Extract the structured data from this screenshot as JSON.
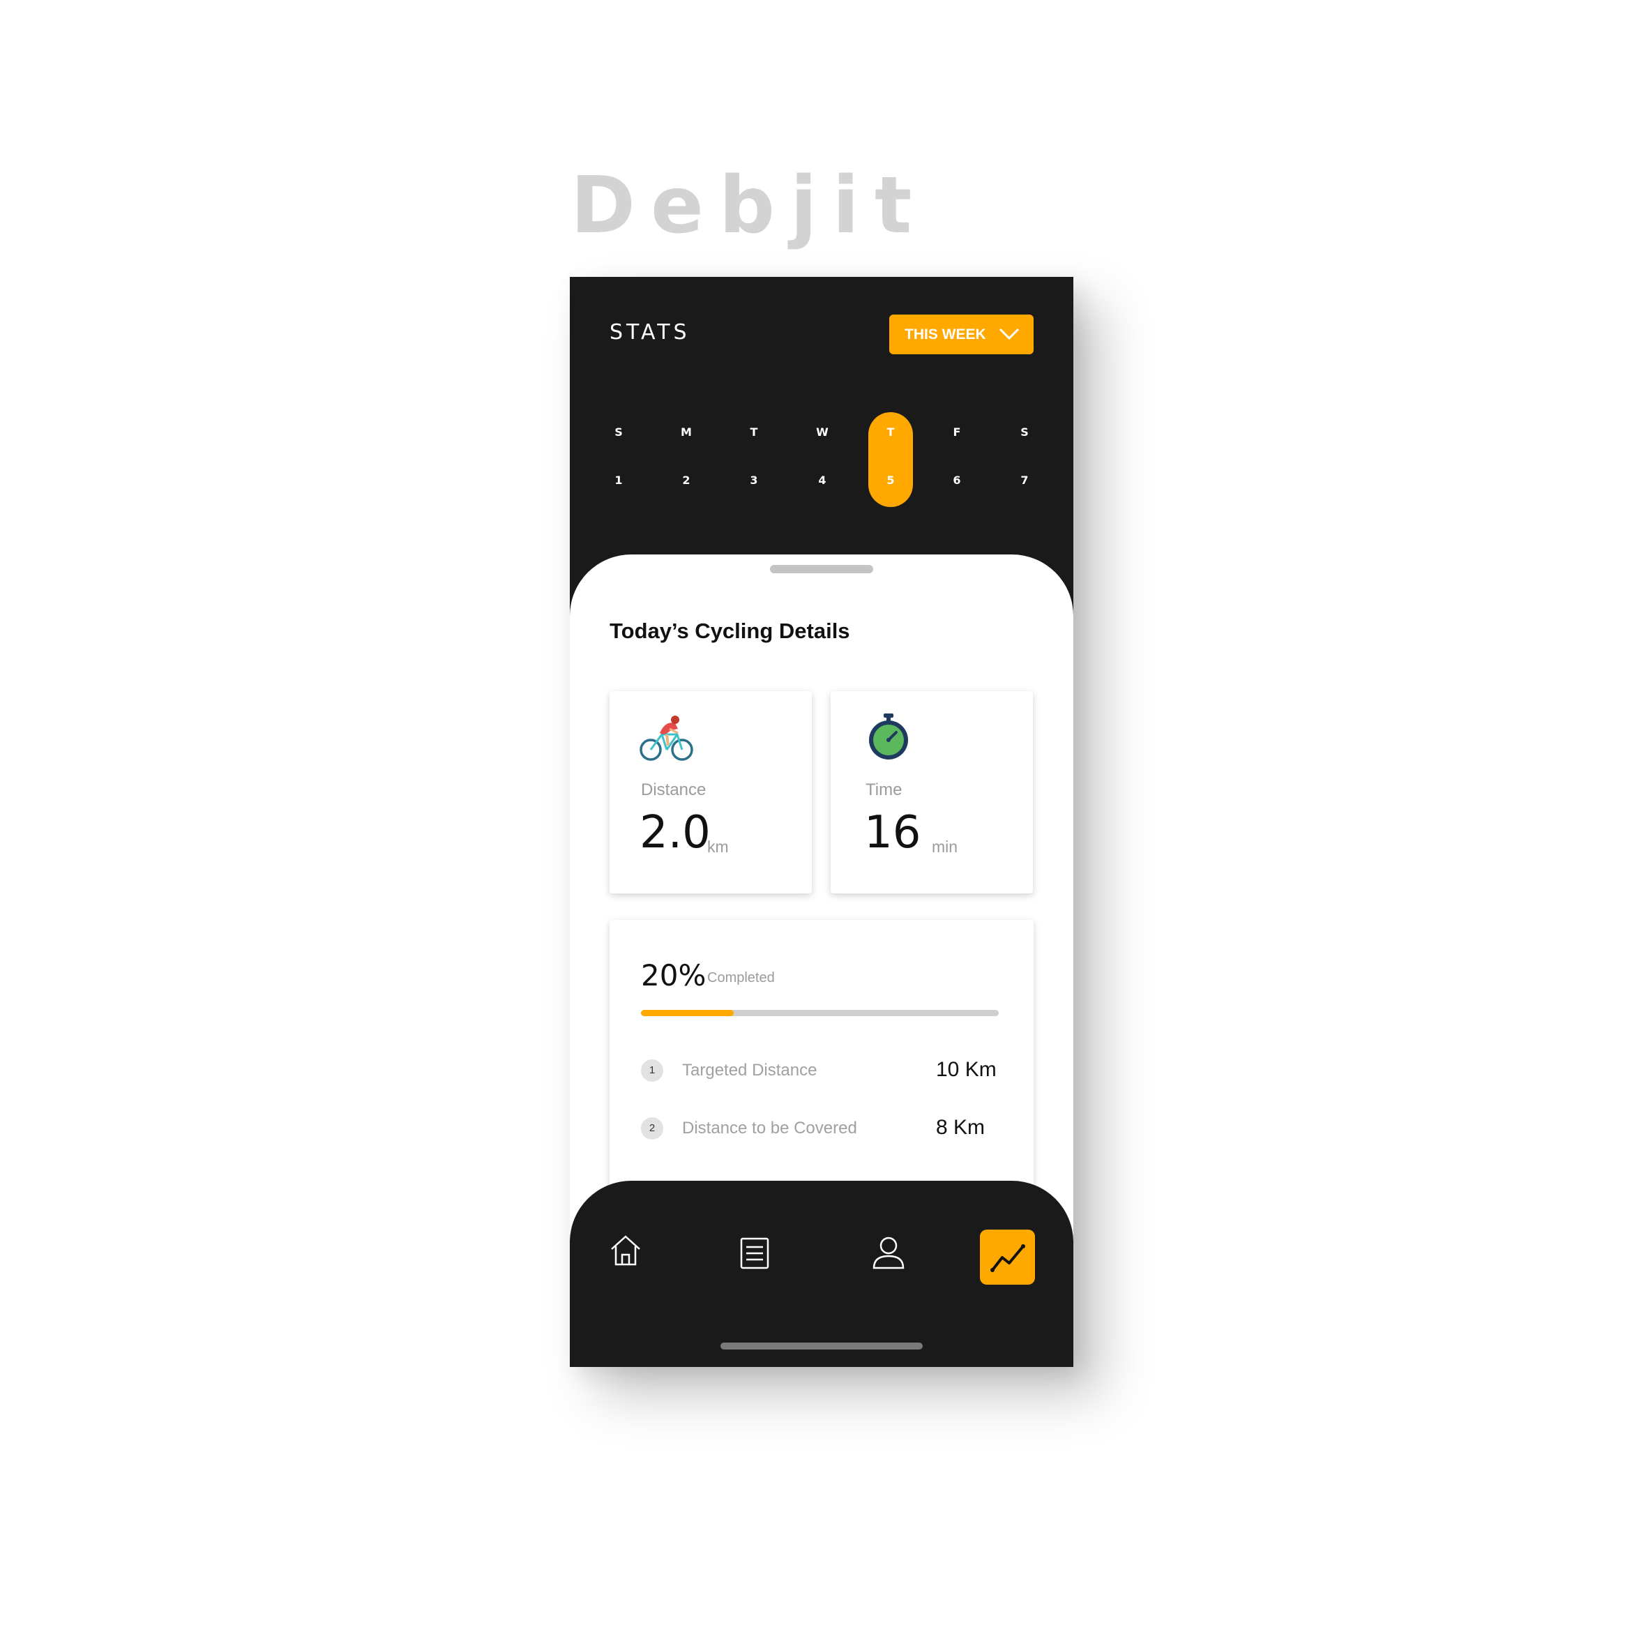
{
  "brand": "Debjit",
  "header": {
    "title": "STATS",
    "range_label": "THIS WEEK"
  },
  "calendar": {
    "days": [
      {
        "letter": "S",
        "date": "1"
      },
      {
        "letter": "M",
        "date": "2"
      },
      {
        "letter": "T",
        "date": "3"
      },
      {
        "letter": "W",
        "date": "4"
      },
      {
        "letter": "T",
        "date": "5"
      },
      {
        "letter": "F",
        "date": "6"
      },
      {
        "letter": "S",
        "date": "7"
      }
    ],
    "selected_index": 4
  },
  "details": {
    "title": "Today’s Cycling Details",
    "distance": {
      "label": "Distance",
      "value": "2.0",
      "unit": "km"
    },
    "time": {
      "label": "Time",
      "value": "16",
      "unit": "min"
    }
  },
  "progress": {
    "percent_text": "20%",
    "label": "Completed",
    "fraction": 0.26,
    "rows": [
      {
        "num": "1",
        "label": "Targeted Distance",
        "value": "10 Km"
      },
      {
        "num": "2",
        "label": "Distance to be Covered",
        "value": "8 Km"
      }
    ]
  },
  "nav": {
    "items": [
      "home-icon",
      "list-icon",
      "profile-icon",
      "stats-icon"
    ],
    "active": "stats-icon"
  },
  "colors": {
    "accent": "#ffa800",
    "dark": "#1a1a1a"
  }
}
